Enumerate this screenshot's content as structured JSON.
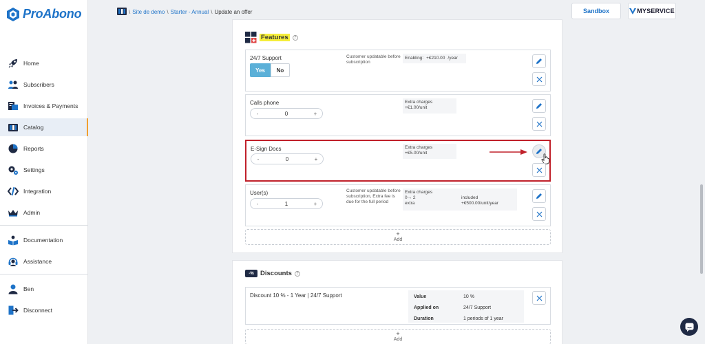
{
  "app": {
    "name": "ProAbono"
  },
  "sidebar": {
    "items": [
      {
        "label": "Home",
        "icon": "rocket-icon"
      },
      {
        "label": "Subscribers",
        "icon": "users-icon"
      },
      {
        "label": "Invoices & Payments",
        "icon": "invoices-icon"
      },
      {
        "label": "Catalog",
        "icon": "catalog-icon",
        "active": true
      },
      {
        "label": "Reports",
        "icon": "pie-chart-icon"
      },
      {
        "label": "Settings",
        "icon": "gear-icon"
      },
      {
        "label": "Integration",
        "icon": "code-icon"
      },
      {
        "label": "Admin",
        "icon": "crown-icon"
      }
    ],
    "help_items": [
      {
        "label": "Documentation",
        "icon": "book-icon"
      },
      {
        "label": "Assistance",
        "icon": "headset-icon"
      }
    ],
    "user_items": [
      {
        "label": "Ben",
        "icon": "user-icon"
      },
      {
        "label": "Disconnect",
        "icon": "logout-icon"
      }
    ]
  },
  "breadcrumb": {
    "site": "Site de demo",
    "offer": "Starter - Annual",
    "current": "Update an offer"
  },
  "header": {
    "sandbox_label": "Sandbox",
    "brand_label": "MYSERVICE"
  },
  "features": {
    "title": "Features",
    "add_label": "Add",
    "items": [
      {
        "name": "24/7 Support",
        "description": "Customer updatable before subscription",
        "pricing": {
          "label": "Enabling:",
          "amount": "+€210.00",
          "period": "/year"
        },
        "toggle": {
          "yes": "Yes",
          "no": "No",
          "selected": "Yes"
        }
      },
      {
        "name": "Calls phone",
        "stepper": {
          "minus": "-",
          "value": "0",
          "plus": "+"
        },
        "charges": {
          "title": "Extra charges",
          "line": "+€1.00/unit"
        }
      },
      {
        "name": "E-Sign Docs",
        "stepper": {
          "minus": "-",
          "value": "0",
          "plus": "+"
        },
        "charges": {
          "title": "Extra charges",
          "line": "+€5.00/unit"
        }
      },
      {
        "name": "User(s)",
        "description": "Customer updatable before subscription, Extra fee is due for the full period",
        "stepper": {
          "minus": "-",
          "value": "1",
          "plus": "+"
        },
        "charges": {
          "title": "Extra charges",
          "range": "0→ 2",
          "included": "included",
          "extra_label": "extra",
          "extra_price": "+€500.00/unit/year"
        }
      }
    ]
  },
  "discounts": {
    "title": "Discounts",
    "badge": "-%",
    "add_label": "Add",
    "item": {
      "name": "Discount 10 % - 1 Year | 24/7 Support",
      "value_label": "Value",
      "value": "10 %",
      "applied_label": "Applied on",
      "applied": "24/7 Support",
      "duration_label": "Duration",
      "duration": "1 periods of 1 year"
    }
  },
  "colors": {
    "accent": "#1e73c8",
    "highlight": "#f5ee3a",
    "annotation": "#c0202a",
    "toggle_on": "#5bb0d8"
  }
}
